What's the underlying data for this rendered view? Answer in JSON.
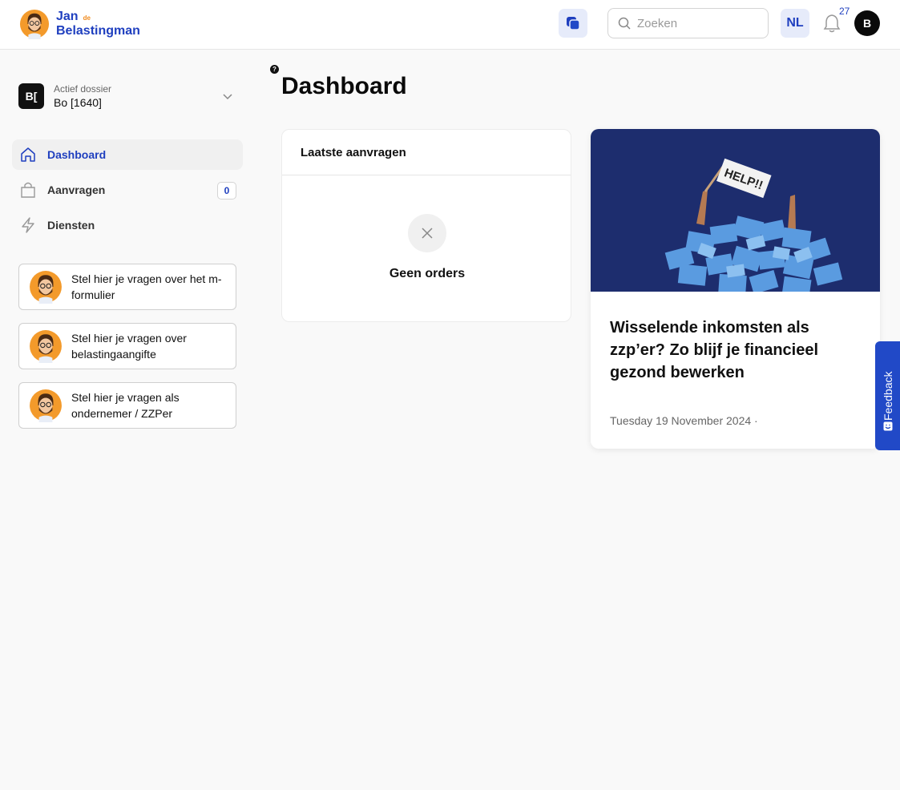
{
  "header": {
    "logo_line1": "Jan",
    "logo_de": "de",
    "logo_line2": "Belastingman",
    "search_placeholder": "Zoeken",
    "language": "NL",
    "notification_count": "27",
    "user_initial": "B"
  },
  "sidebar": {
    "dossier_label": "Actief dossier",
    "dossier_value": "Bo [1640]",
    "dossier_badge": "B[",
    "nav": [
      {
        "label": "Dashboard",
        "icon": "home-icon",
        "active": true
      },
      {
        "label": "Aanvragen",
        "icon": "shopping-bag-icon",
        "badge": "0"
      },
      {
        "label": "Diensten",
        "icon": "lightning-icon"
      }
    ],
    "help_cards": [
      {
        "text": "Stel hier je vragen over het m-formulier"
      },
      {
        "text": "Stel hier je vragen over belastingaangifte"
      },
      {
        "text": "Stel hier je vragen als ondernemer / ZZPer"
      }
    ]
  },
  "main": {
    "help_marker": "?",
    "title": "Dashboard",
    "orders": {
      "title": "Laatste aanvragen",
      "empty_text": "Geen orders"
    },
    "news": {
      "image_sign_text": "HELP!!",
      "title": "Wisselende inkomsten als zzp’er? Zo blijf je financieel gezond bewerken",
      "date": "Tuesday 19 November 2024 ·"
    }
  },
  "feedback": {
    "label": "Feedback"
  },
  "colors": {
    "brand_blue": "#1f3fbf",
    "brand_orange": "#f08a1c",
    "feedback_blue": "#2149c7",
    "news_image_bg": "#1d2d6e"
  }
}
